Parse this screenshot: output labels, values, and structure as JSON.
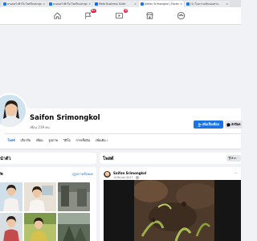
{
  "browser": {
    "tabs": [
      {
        "label": "ครอบครัวฟ้าใส โพสใหม่ล่าสุด",
        "active": false,
        "favicon": "#1877f2"
      },
      {
        "label": "ครอบครัวฟ้าใส โพสใหม่ล่าสุด",
        "active": false,
        "favicon": "#1877f2"
      },
      {
        "label": "Meta Business Suite",
        "active": false,
        "favicon": "#0866ff"
      },
      {
        "label": "Saifon Srimongkol | Faceb",
        "active": true,
        "favicon": "#1877f2"
      },
      {
        "label": "(1) ในความเห็นของท่าน",
        "active": false,
        "favicon": "#1877f2"
      }
    ],
    "close_glyph": "×"
  },
  "nav": {
    "icons": [
      "home-icon",
      "flag-icon",
      "play-icon",
      "marketplace-icon",
      "groups-icon"
    ],
    "badge_flag": "9+",
    "badge_play": "9"
  },
  "profile": {
    "name": "Saifon Srimongkol",
    "friends": "เพื่อน 239 คน",
    "add_friend": "เพิ่มเป็นเพื่อน",
    "message": "ส่งข้อค",
    "tabs": [
      "โพสต์",
      "เกี่ยวกับ",
      "เพื่อน",
      "รูปภาพ",
      "วิดีโอ",
      "การเช็คอิน",
      "เพิ่มเติม"
    ],
    "more_caret": "▾"
  },
  "intro": {
    "title": "นำตัว"
  },
  "photos": {
    "title": "พ",
    "see_all": "ดูรูปภาพทั้งหมด"
  },
  "posts": {
    "title": "โพสต์",
    "filter": "ตัวก",
    "author": "Saifon Srimongkol",
    "date": "14 มีนาคม 2017 · ",
    "more_glyph": "···"
  },
  "colors": {
    "accent": "#1b74e4",
    "badge": "#e41e3f"
  }
}
